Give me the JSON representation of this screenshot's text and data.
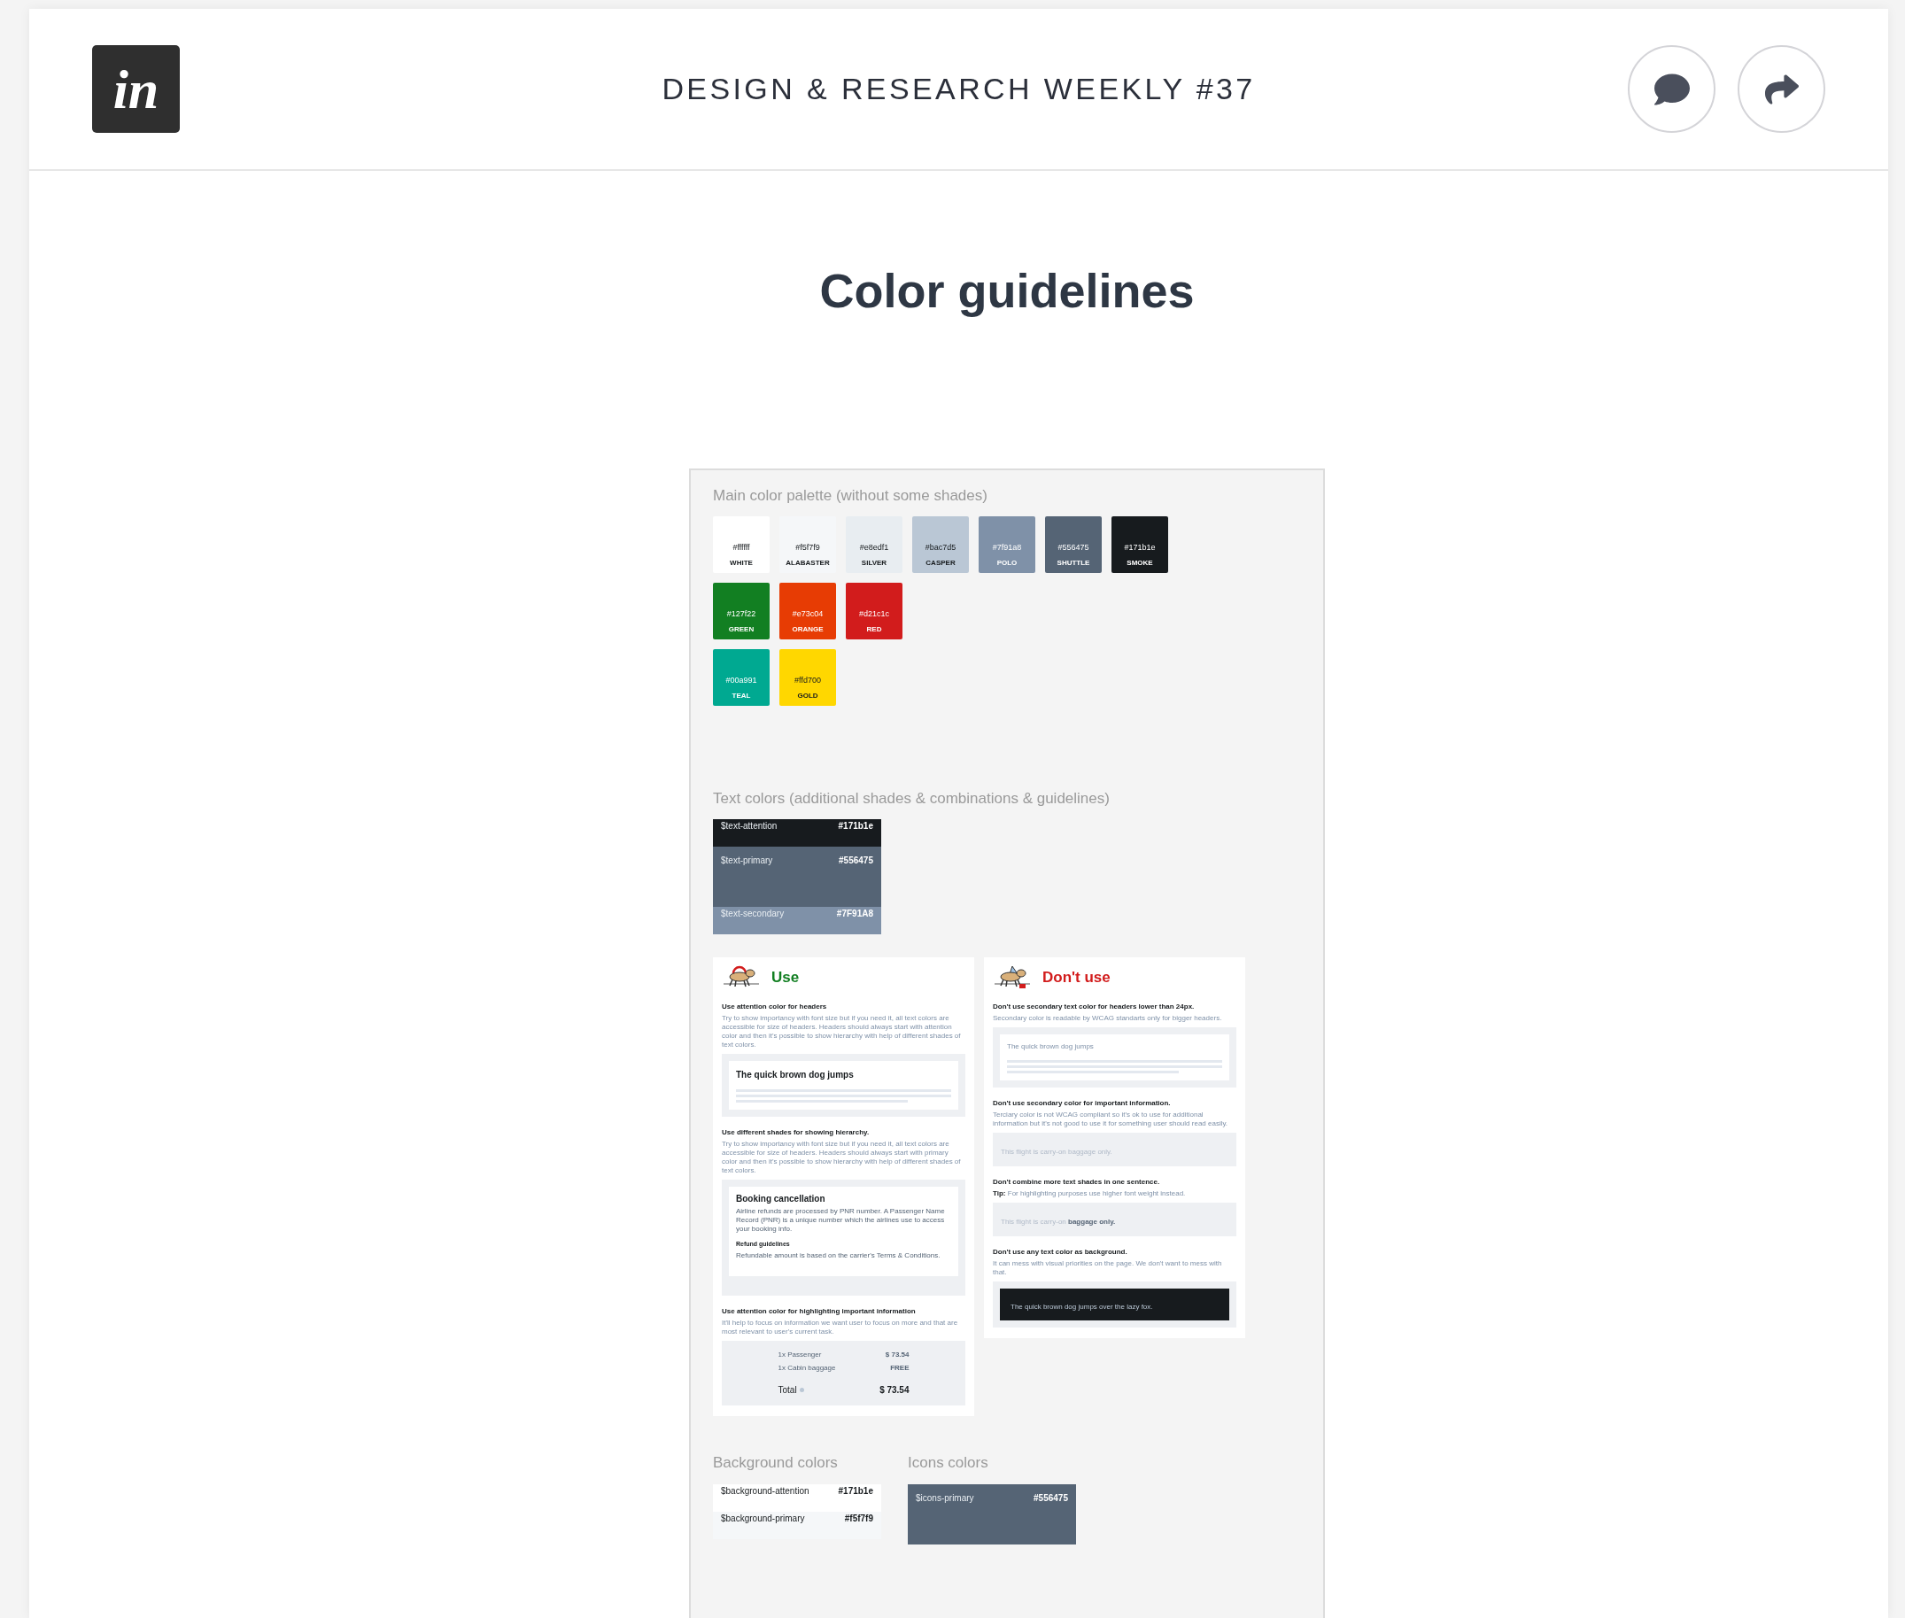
{
  "header": {
    "logo": "in",
    "title": "DESIGN & RESEARCH WEEKLY #37"
  },
  "page_title": "Color guidelines",
  "board": {
    "palette": {
      "title": "Main color palette (without some shades)",
      "groups": [
        {
          "swatches": [
            {
              "hex": "#ffffff",
              "name": "WHITE",
              "color": "#ffffff"
            },
            {
              "hex": "#f5f7f9",
              "name": "ALABASTER",
              "color": "#f5f7f9"
            },
            {
              "hex": "#e8edf1",
              "name": "SILVER",
              "color": "#e8edf1"
            },
            {
              "hex": "#bac7d5",
              "name": "CASPER",
              "color": "#bac7d5"
            },
            {
              "hex": "#7f91a8",
              "name": "POLO",
              "color": "#7f91a8"
            },
            {
              "hex": "#556475",
              "name": "SHUTTLE",
              "color": "#556475"
            },
            {
              "hex": "#171b1e",
              "name": "SMOKE",
              "color": "#171b1e"
            }
          ]
        },
        {
          "swatches": [
            {
              "hex": "#127f22",
              "name": "GREEN",
              "color": "#127f22"
            },
            {
              "hex": "#e73c04",
              "name": "ORANGE",
              "color": "#e73c04"
            },
            {
              "hex": "#d21c1c",
              "name": "RED",
              "color": "#d21c1c"
            }
          ]
        },
        {
          "swatches": [
            {
              "hex": "#00a991",
              "name": "TEAL",
              "color": "#00a991"
            },
            {
              "hex": "#ffd700",
              "name": "GOLD",
              "color": "#ffd700"
            }
          ]
        }
      ]
    },
    "text_colors": {
      "title": "Text colors (additional shades & combinations & guidelines)",
      "rows": [
        {
          "name": "$text-attention",
          "hex": "#171b1e",
          "color": "#171b1e"
        },
        {
          "name": "$text-primary",
          "hex": "#556475",
          "color": "#556475"
        },
        {
          "name": "$text-secondary",
          "hex": "#7F91A8",
          "color": "#7f91a8"
        }
      ]
    },
    "use": {
      "title": "Use",
      "sections": [
        {
          "heading": "Use attention color for headers",
          "text": "Try to show importancy with font size but if you need it, all text colors are accessible for size of headers. Headers should always start with attention color and then it's possible to show hierarchy with help of different shades of text colors.",
          "example": {
            "kind": "headline",
            "muted": false,
            "title": "The quick brown dog jumps"
          }
        },
        {
          "heading": "Use different shades for showing hierarchy.",
          "text": "Try to show importancy with font size but if you need it, all text colors are accessible for size of headers. Headers should always start with primary color and then it's possible to show hierarchy with help of different shades of text colors.",
          "example": {
            "kind": "article",
            "title": "Booking cancellation",
            "body": "Airline refunds are processed by PNR number. A Passenger Name Record  (PNR) is a unique number which the airlines use to access your booking info.",
            "subtitle": "Refund guidelines",
            "subbody": "Refundable amount is based on the carrier's Terms & Conditions."
          }
        },
        {
          "heading": "Use attention color for highlighting important information",
          "text": "It'll help to focus on information we want user to focus on more and that are most relevant to user's current task.",
          "example": {
            "kind": "price",
            "lines": [
              {
                "label": "1x Passenger",
                "value": "$ 73.54"
              },
              {
                "label": "1x Cabin baggage",
                "value": "FREE"
              }
            ],
            "total_label": "Total",
            "total": "$ 73.54"
          }
        }
      ]
    },
    "dont_use": {
      "title": "Don't use",
      "sections": [
        {
          "heading": "Don't use secondary text color for headers lower than 24px.",
          "text": "Secondary color is readable by WCAG standarts only for bigger headers.",
          "example": {
            "kind": "headline",
            "muted": true,
            "title": "The quick brown dog jumps"
          }
        },
        {
          "heading": "Don't use secondary color for important information.",
          "text": "Terciary color is not WCAG compliant so it's ok to use for additional information but it's not good to use it for something user should read easily.",
          "example": {
            "kind": "note",
            "text": "This flight is carry-on baggage only."
          }
        },
        {
          "heading": "Don't combine more text shades in one sentence.",
          "text": "**Tip:** For highlighting purposes use higher font weight instead.",
          "example": {
            "kind": "note",
            "text": "This flight is carry-on **baggage only.**"
          }
        },
        {
          "heading": "Don't use any text color as background.",
          "text": "It can mess with visual priorities on the page. We don't want to mess with that.",
          "example": {
            "kind": "banner",
            "text": "The quick brown dog jumps over the lazy fox."
          }
        }
      ]
    },
    "background_colors": {
      "title": "Background colors",
      "rows": [
        {
          "name": "$background-attention",
          "hex": "#171b1e",
          "color": "#ffffff"
        },
        {
          "name": "$background-primary",
          "hex": "#f5f7f9",
          "color": "#f5f7f9"
        }
      ]
    },
    "icon_colors": {
      "title": "Icons colors",
      "rows": [
        {
          "name": "$icons-primary",
          "hex": "#556475",
          "color": "#556475"
        }
      ]
    }
  }
}
